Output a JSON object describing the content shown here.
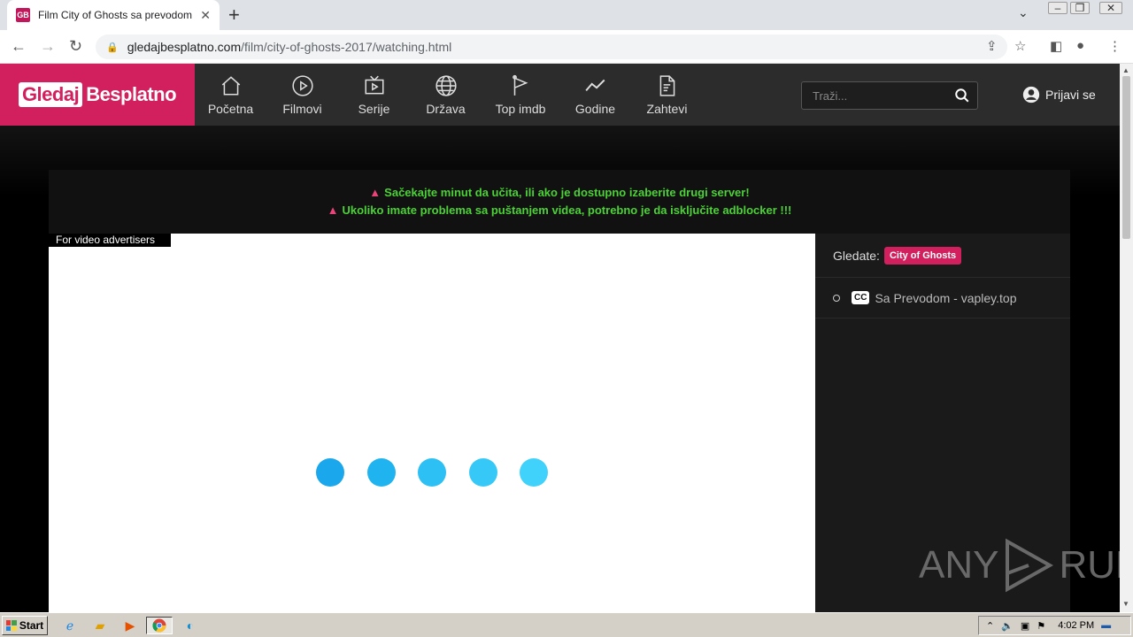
{
  "browser": {
    "tab_title": "Film City of Ghosts sa prevodom onli",
    "tab_favicon": "GB",
    "url_host": "gledajbesplatno.com",
    "url_path": "/film/city-of-ghosts-2017/watching.html"
  },
  "site": {
    "logo_part1": "Gledaj",
    "logo_part2": "Besplatno",
    "nav": [
      {
        "label": "Početna",
        "icon": "home-icon"
      },
      {
        "label": "Filmovi",
        "icon": "play-icon"
      },
      {
        "label": "Serije",
        "icon": "tv-icon"
      },
      {
        "label": "Država",
        "icon": "globe-icon"
      },
      {
        "label": "Top imdb",
        "icon": "flag-icon"
      },
      {
        "label": "Godine",
        "icon": "trend-icon"
      },
      {
        "label": "Zahtevi",
        "icon": "request-icon"
      }
    ],
    "search_placeholder": "Traži...",
    "login_label": "Prijavi se"
  },
  "notice": {
    "line1": "Sačekajte minut da učita, ili ako je dostupno izaberite drugi server!",
    "line2": "Ukoliko imate problema sa puštanjem videa, potrebno je da isključite adblocker !!!"
  },
  "player": {
    "ad_label": "For video advertisers",
    "loader_colors": [
      "#1aa7ec",
      "#1fb4f0",
      "#2cc0f5",
      "#36c9f8",
      "#40d2fb"
    ]
  },
  "sidebar": {
    "watching_label": "Gledate:",
    "watching_title": "City of Ghosts",
    "server_cc": "CC",
    "server_label": "Sa Prevodom - vapley.top"
  },
  "watermark": {
    "left": "ANY",
    "right": "RUN"
  },
  "taskbar": {
    "start_label": "Start",
    "clock": "4:02 PM"
  },
  "colors": {
    "accent": "#d1205d",
    "notice_text": "#4cd137",
    "warning": "#e8447a"
  }
}
